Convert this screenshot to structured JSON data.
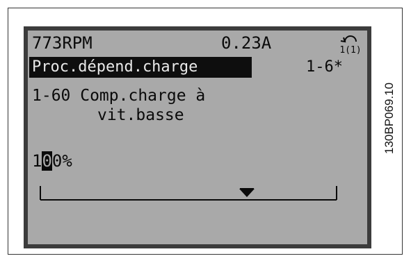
{
  "status": {
    "speed": "773RPM",
    "current": "0.23A",
    "setup_indicator": "1(1)"
  },
  "menu": {
    "group_label": "Proc.dépend.charge",
    "group_index": "1-6*"
  },
  "parameter": {
    "line1": "1-60 Comp.charge à",
    "line2": "vit.basse"
  },
  "value": {
    "before_cursor": "1",
    "cursor_digit": "0",
    "after_cursor": "0",
    "unit": "%"
  },
  "figure_code": "130BP069.10",
  "icons": [
    "setup-icon",
    "scale-pointer-icon"
  ]
}
